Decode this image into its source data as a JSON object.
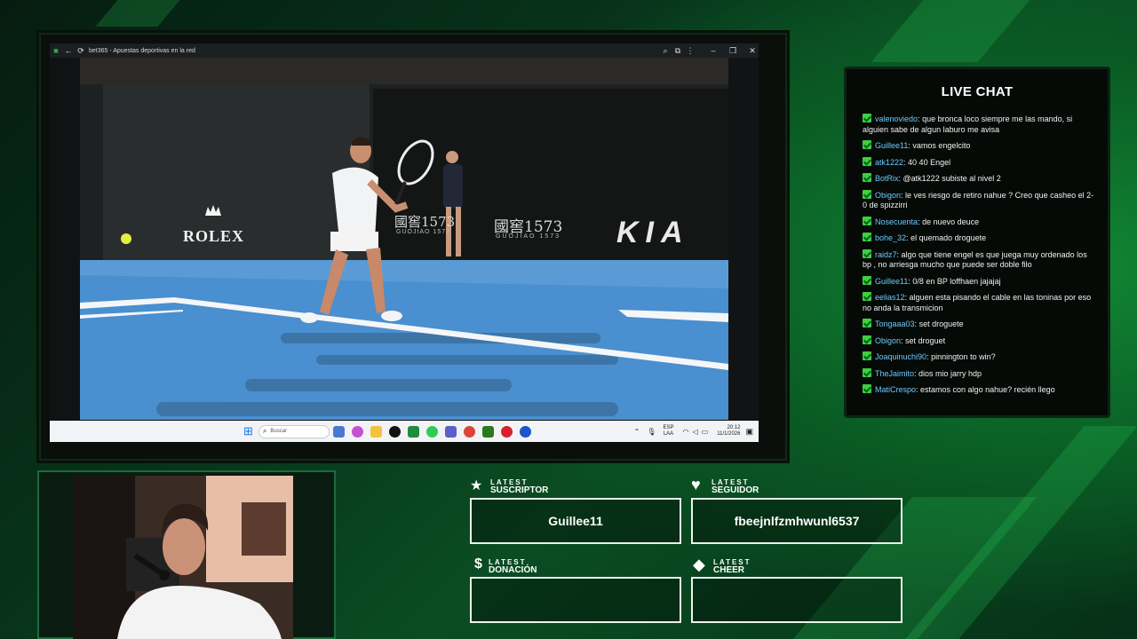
{
  "browser": {
    "title": "bet365 - Apuestas deportivas en la red"
  },
  "video": {
    "ads": {
      "rolex": "ROLEX",
      "guojiao": "國窖1573",
      "guojiao_sub": "GUOJIAO 1573",
      "kia": "KIA"
    }
  },
  "taskbar": {
    "search_placeholder": "Buscar",
    "lang": "ESP",
    "lang2": "LAA",
    "time": "20:12",
    "date": "11/1/2026"
  },
  "chat": {
    "title": "LIVE CHAT",
    "messages": [
      {
        "user": "valenoviedo",
        "text": "que bronca loco siempre me las mando, si alguien sabe de algun laburo me avisa"
      },
      {
        "user": "Guillee11",
        "text": "vamos engelcito"
      },
      {
        "user": "atk1222",
        "text": "40 40 Engel"
      },
      {
        "user": "BotRix",
        "text": "@atk1222 subiste al nivel 2"
      },
      {
        "user": "Obigon",
        "text": "le ves riesgo de retiro nahue ? Creo que casheo el 2-0 de spizzirri"
      },
      {
        "user": "Nosecuenta",
        "text": "de nuevo deuce"
      },
      {
        "user": "bohe_32",
        "text": "el quemado droguete"
      },
      {
        "user": "raidz7",
        "text": "algo que tiene engel es que juega muy ordenado los bp , no arriesga mucho que puede ser doble filo"
      },
      {
        "user": "Guillee11",
        "text": "0/8 en BP loffhaen jajajaj"
      },
      {
        "user": "eelias12",
        "text": "alguen esta pisando el cable en las toninas por eso no anda la transmicion"
      },
      {
        "user": "Tongaaa03",
        "text": "set droguete"
      },
      {
        "user": "Obigon",
        "text": "set droguet"
      },
      {
        "user": "Joaquinuchi90",
        "text": "pinnington to win?"
      },
      {
        "user": "TheJaimito",
        "text": "dios mio jarry hdp"
      },
      {
        "user": "MatiCrespo",
        "text": "estamos con algo nahue? recién llego"
      }
    ]
  },
  "widgets": {
    "suscriptor": {
      "small": "LATEST",
      "big": "SUSCRIPTOR",
      "value": "Guillee11"
    },
    "seguidor": {
      "small": "LATEST",
      "big": "SEGUIDOR",
      "value": "fbeejnlfzmhwunl6537"
    },
    "donacion": {
      "small": "LATEST",
      "big": "DONACIÓN",
      "value": ""
    },
    "cheer": {
      "small": "LATEST",
      "big": "CHEER",
      "value": ""
    }
  },
  "colors": {
    "accent": "#3fcf3f",
    "username": "#6ec9ff",
    "court": "#4a8fcf"
  },
  "icons": [
    "star-icon",
    "heart-icon",
    "dollar-icon",
    "diamond-icon",
    "windows-icon",
    "search-icon",
    "back-icon",
    "refresh-icon",
    "close-icon"
  ]
}
